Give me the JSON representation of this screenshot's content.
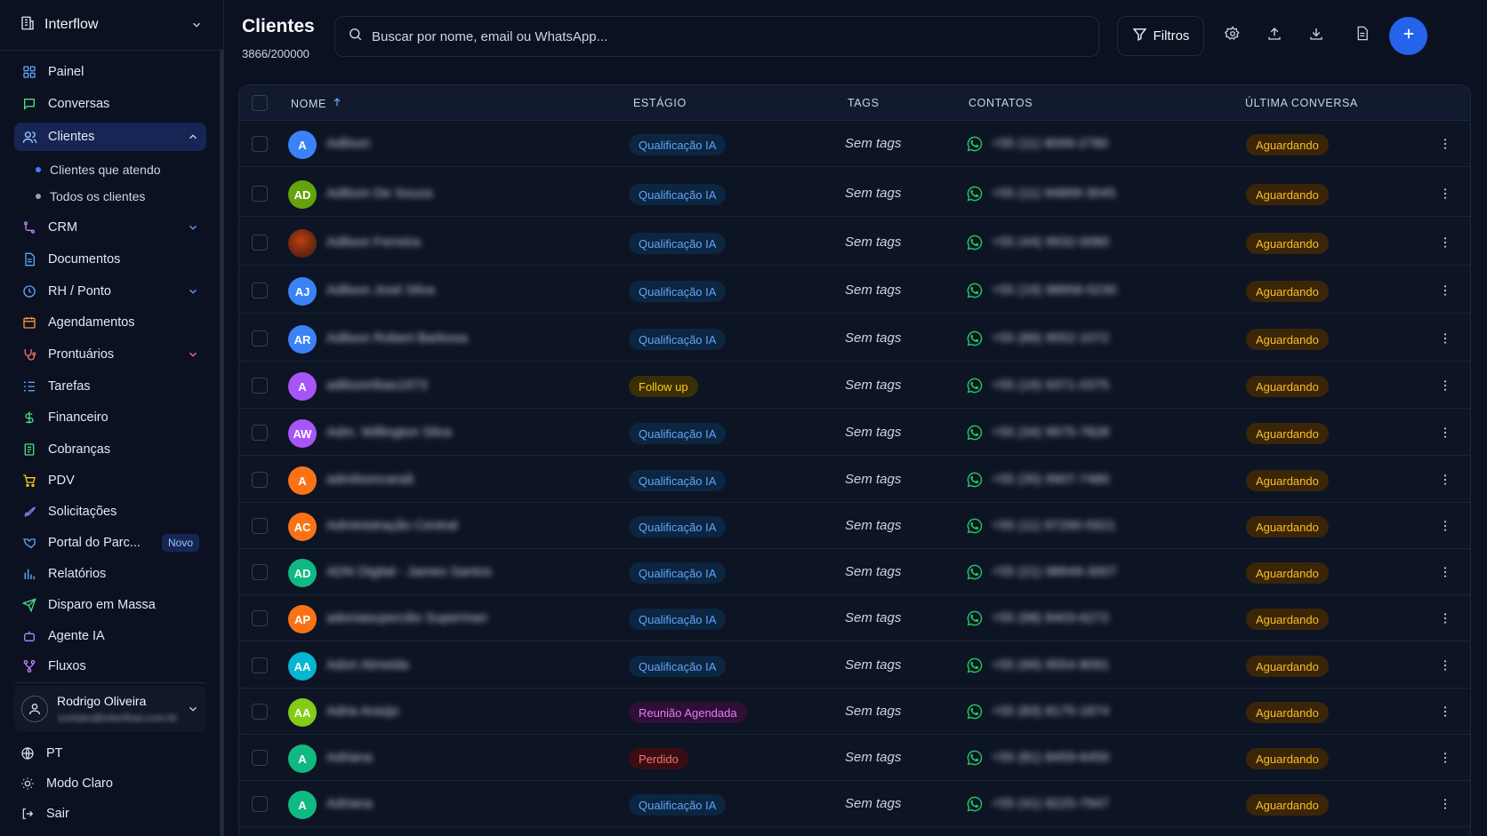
{
  "colors": {
    "background": "#0b1120",
    "accent": "#2563eb",
    "whatsapp": "#22c55e",
    "status_waiting_bg": "#3b2508",
    "status_waiting_fg": "#fbbf24"
  },
  "sidebar": {
    "brand": "Interflow",
    "items": [
      {
        "label": "Painel",
        "icon": "grid-icon"
      },
      {
        "label": "Conversas",
        "icon": "chat-icon"
      },
      {
        "label": "Clientes",
        "icon": "users-icon",
        "active": true,
        "expanded": true
      },
      {
        "label": "CRM",
        "icon": "crm-icon"
      },
      {
        "label": "Documentos",
        "icon": "document-icon"
      },
      {
        "label": "RH / Ponto",
        "icon": "clock-icon"
      },
      {
        "label": "Agendamentos",
        "icon": "calendar-icon"
      },
      {
        "label": "Prontuários",
        "icon": "stethoscope-icon"
      },
      {
        "label": "Tarefas",
        "icon": "tasks-icon"
      },
      {
        "label": "Financeiro",
        "icon": "dollar-icon"
      },
      {
        "label": "Cobranças",
        "icon": "invoice-icon"
      },
      {
        "label": "PDV",
        "icon": "cart-icon"
      },
      {
        "label": "Solicitações",
        "icon": "rocket-icon"
      },
      {
        "label": "Portal do Parc...",
        "icon": "handshake-icon",
        "badge": "Novo"
      },
      {
        "label": "Relatórios",
        "icon": "bar-chart-icon"
      },
      {
        "label": "Disparo em Massa",
        "icon": "send-icon"
      },
      {
        "label": "Agente IA",
        "icon": "bot-icon"
      },
      {
        "label": "Fluxos",
        "icon": "flow-icon"
      }
    ],
    "clientes_sub": [
      "Clientes que atendo",
      "Todos os clientes"
    ],
    "user": {
      "name": "Rodrigo Oliveira",
      "email": "contato@interflow.com.br"
    },
    "footer": [
      {
        "label": "PT",
        "icon": "globe-icon"
      },
      {
        "label": "Modo Claro",
        "icon": "sun-icon"
      },
      {
        "label": "Sair",
        "icon": "logout-icon"
      }
    ]
  },
  "header": {
    "title": "Clientes",
    "count": "3866/200000",
    "search_placeholder": "Buscar por nome, email ou WhatsApp...",
    "filter_label": "Filtros"
  },
  "table": {
    "columns": {
      "name": "NOME",
      "stage": "ESTÁGIO",
      "tags": "TAGS",
      "contacts": "CONTATOS",
      "last": "ÚLTIMA CONVERSA"
    },
    "rows": [
      {
        "initials": "A",
        "avatar_color": "#3b82f6",
        "name": "Adilson",
        "stage": "Qualificação IA",
        "stage_type": "ia",
        "tags": "Sem tags",
        "phone": "+55 (11) 8099-2780",
        "status": "Aguardando"
      },
      {
        "initials": "AD",
        "avatar_color": "#65a30d",
        "name": "Adilson De Souza",
        "stage": "Qualificação IA",
        "stage_type": "ia",
        "tags": "Sem tags",
        "phone": "+55 (11) 94899-3045",
        "status": "Aguardando"
      },
      {
        "initials": "",
        "avatar_color": "photo",
        "name": "Adilson Ferreira",
        "stage": "Qualificação IA",
        "stage_type": "ia",
        "tags": "Sem tags",
        "phone": "+55 (44) 9932-0080",
        "status": "Aguardando"
      },
      {
        "initials": "AJ",
        "avatar_color": "#3b82f6",
        "name": "Adilson José Silva",
        "stage": "Qualificação IA",
        "stage_type": "ia",
        "tags": "Sem tags",
        "phone": "+55 (19) 98956-5230",
        "status": "Aguardando"
      },
      {
        "initials": "AR",
        "avatar_color": "#3b82f6",
        "name": "Adilson Robert Barbosa",
        "stage": "Qualificação IA",
        "stage_type": "ia",
        "tags": "Sem tags",
        "phone": "+55 (89) 9552-1072",
        "status": "Aguardando"
      },
      {
        "initials": "A",
        "avatar_color": "#a855f7",
        "name": "adilsonribas1973",
        "stage": "Follow up",
        "stage_type": "follow",
        "tags": "Sem tags",
        "phone": "+55 (19) 9371-0375",
        "status": "Aguardando"
      },
      {
        "initials": "AW",
        "avatar_color": "#a855f7",
        "name": "Adm. Willington Silva",
        "stage": "Qualificação IA",
        "stage_type": "ia",
        "tags": "Sem tags",
        "phone": "+55 (34) 9975-7828",
        "status": "Aguardando"
      },
      {
        "initials": "A",
        "avatar_color": "#f97316",
        "name": "admilsoncaraã",
        "stage": "Qualificação IA",
        "stage_type": "ia",
        "tags": "Sem tags",
        "phone": "+55 (35) 9907-7480",
        "status": "Aguardando"
      },
      {
        "initials": "AC",
        "avatar_color": "#f97316",
        "name": "Administração Central",
        "stage": "Qualificação IA",
        "stage_type": "ia",
        "tags": "Sem tags",
        "phone": "+55 (11) 97290-5921",
        "status": "Aguardando"
      },
      {
        "initials": "AD",
        "avatar_color": "#10b981",
        "name": "ADN Digital - James Santos",
        "stage": "Qualificação IA",
        "stage_type": "ia",
        "tags": "Sem tags",
        "phone": "+55 (21) 98949-3007",
        "status": "Aguardando"
      },
      {
        "initials": "AP",
        "avatar_color": "#f97316",
        "name": "adoniascpercilio Superman",
        "stage": "Qualificação IA",
        "stage_type": "ia",
        "tags": "Sem tags",
        "phone": "+55 (98) 8403-6272",
        "status": "Aguardando"
      },
      {
        "initials": "AA",
        "avatar_color": "#06b6d4",
        "name": "Adori Almeida",
        "stage": "Qualificação IA",
        "stage_type": "ia",
        "tags": "Sem tags",
        "phone": "+55 (99) 9554-8091",
        "status": "Aguardando"
      },
      {
        "initials": "AA",
        "avatar_color": "#84cc16",
        "name": "Adria Araújo",
        "stage": "Reunião Agendada",
        "stage_type": "meeting",
        "tags": "Sem tags",
        "phone": "+55 (83) 8175-1874",
        "status": "Aguardando"
      },
      {
        "initials": "A",
        "avatar_color": "#10b981",
        "name": "Adriana",
        "stage": "Perdido",
        "stage_type": "lost",
        "tags": "Sem tags",
        "phone": "+55 (81) 8459-6450",
        "status": "Aguardando"
      },
      {
        "initials": "A",
        "avatar_color": "#10b981",
        "name": "Adriana",
        "stage": "Qualificação IA",
        "stage_type": "ia",
        "tags": "Sem tags",
        "phone": "+55 (41) 8225-7947",
        "status": "Aguardando"
      }
    ]
  }
}
